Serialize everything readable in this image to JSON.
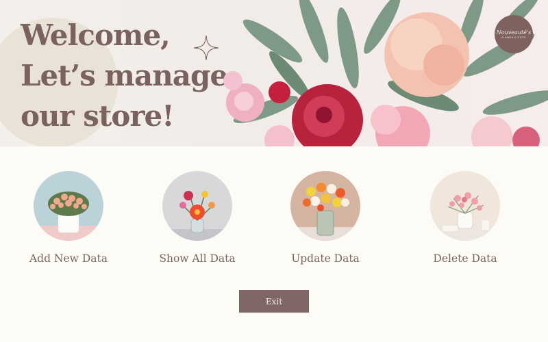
{
  "header": {
    "welcome_lines": [
      "Welcome,",
      "Let’s manage",
      "our store!"
    ],
    "logo": {
      "name": "Nouveauté's",
      "tagline": "FLOWER & GIFTS"
    }
  },
  "actions": [
    {
      "label": "Add New Data",
      "icon": "white-vase-peach-roses"
    },
    {
      "label": "Show All Data",
      "icon": "glass-vase-mixed-flowers"
    },
    {
      "label": "Update Data",
      "icon": "glass-vase-poppies"
    },
    {
      "label": "Delete Data",
      "icon": "white-vase-pink-blossoms"
    }
  ],
  "exit_button": {
    "label": "Exit"
  },
  "colors": {
    "brand": "#7e6764",
    "heading": "#7a625e",
    "background": "#fdfbf5"
  }
}
